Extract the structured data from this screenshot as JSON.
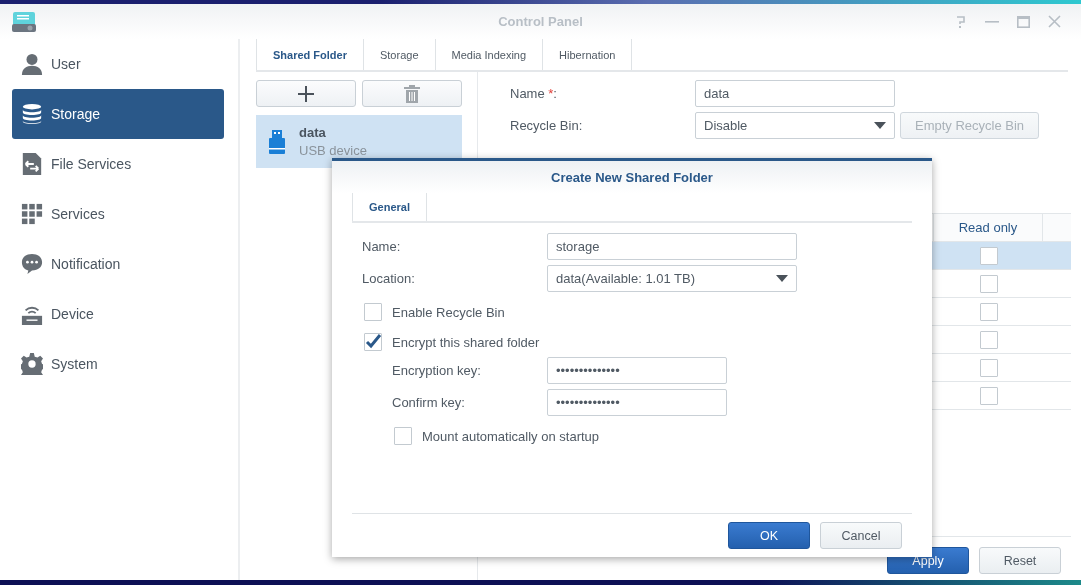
{
  "window": {
    "title": "Control Panel"
  },
  "sidebar": {
    "items": [
      {
        "label": "User",
        "selected": false
      },
      {
        "label": "Storage",
        "selected": true
      },
      {
        "label": "File Services",
        "selected": false
      },
      {
        "label": "Services",
        "selected": false
      },
      {
        "label": "Notification",
        "selected": false
      },
      {
        "label": "Device",
        "selected": false
      },
      {
        "label": "System",
        "selected": false
      }
    ]
  },
  "tabs": [
    {
      "label": "Shared Folder",
      "selected": true
    },
    {
      "label": "Storage",
      "selected": false
    },
    {
      "label": "Media Indexing",
      "selected": false
    },
    {
      "label": "Hibernation",
      "selected": false
    }
  ],
  "shared_folders": [
    {
      "name": "data",
      "subtitle": "USB device",
      "selected": true
    }
  ],
  "settings": {
    "name_label": "Name ",
    "required_mark": "*",
    "name_colon": ":",
    "name_value": "data",
    "recycle_label": "Recycle Bin:",
    "recycle_value": "Disable",
    "empty_button": {
      "label": "Empty Recycle Bin",
      "disabled": true
    }
  },
  "permissions": {
    "columns": [
      "Read only"
    ],
    "rows": [
      {
        "selected": true,
        "read_only": false
      },
      {
        "selected": false,
        "read_only": false
      },
      {
        "selected": false,
        "read_only": false
      },
      {
        "selected": false,
        "read_only": false
      },
      {
        "selected": false,
        "read_only": false
      },
      {
        "selected": false,
        "read_only": false
      }
    ]
  },
  "footer_buttons": [
    "Apply",
    "Reset"
  ],
  "dialog": {
    "title": "Create New Shared Folder",
    "tabs": [
      {
        "label": "General",
        "selected": true
      }
    ],
    "fields": [
      {
        "kind": "text",
        "label": "Name:",
        "value": "storage"
      },
      {
        "kind": "select",
        "label": "Location:",
        "value": "data(Available: 1.01 TB)"
      },
      {
        "kind": "checkbox",
        "label": "Enable Recycle Bin",
        "checked": false
      },
      {
        "kind": "checkbox",
        "label": "Encrypt this shared folder",
        "checked": true,
        "children": [
          {
            "kind": "password",
            "label": "Encryption key:",
            "value": "••••••••••••••"
          },
          {
            "kind": "password",
            "label": "Confirm key:",
            "value": "••••••••••••••"
          },
          {
            "kind": "checkbox",
            "label": "Mount automatically on startup",
            "checked": false
          }
        ]
      }
    ],
    "buttons": [
      "OK",
      "Cancel"
    ]
  }
}
